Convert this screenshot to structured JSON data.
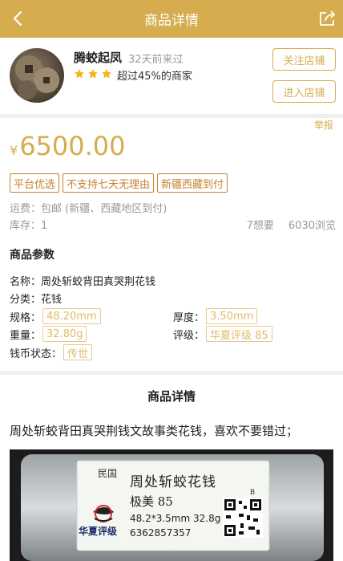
{
  "nav": {
    "title": "商品详情"
  },
  "shop": {
    "name": "腾蛟起凤",
    "last_visit": "32天前来过",
    "rank_text": "超过45%的商家",
    "star_count": 3,
    "follow_label": "关注店铺",
    "enter_label": "进入店铺"
  },
  "product": {
    "report_label": "举报",
    "currency": "¥",
    "price": "6500.00",
    "tags": [
      "平台优选",
      "不支持七天无理由",
      "新疆西藏到付"
    ],
    "shipping": "运费：包邮 (新疆、西藏地区到付)",
    "stock": "库存：1",
    "wants": "7想要",
    "views": "6030浏览"
  },
  "params": {
    "title": "商品参数",
    "name_label": "名称：",
    "name_value": "周处斩蛟背田真哭荆花钱",
    "category_label": "分类：",
    "category_value": "花钱",
    "spec_label": "规格：",
    "spec_value": "48.20mm",
    "thickness_label": "厚度：",
    "thickness_value": "3.50mm",
    "weight_label": "重量：",
    "weight_value": "32.80g",
    "grade_label": "评级：",
    "grade_value": "华夏评级 85",
    "status_label": "钱币状态：",
    "status_value": "传世"
  },
  "detail": {
    "title": "商品详情",
    "text": "周处斩蛟背田真哭荆钱文故事类花钱，喜欢不要错过；"
  },
  "photo": {
    "period": "民国",
    "coin_name": "周处斩蛟花钱",
    "grade": "极美 85",
    "size": "48.2*3.5mm 32.8g",
    "brand": "华夏评级",
    "serial": "6362857357",
    "corner": "B"
  },
  "colors": {
    "accent": "#d5ad4e",
    "tag": "#c8822e",
    "divider": "#efefef"
  }
}
